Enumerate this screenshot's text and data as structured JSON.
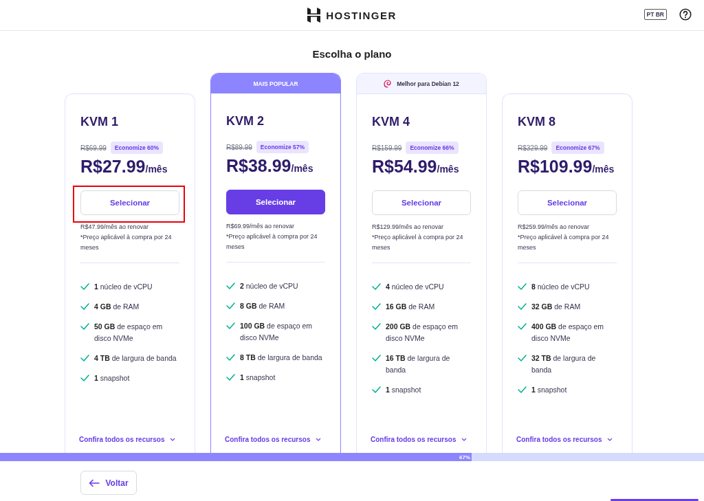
{
  "header": {
    "brand": "HOSTINGER",
    "language": "PT BR"
  },
  "title": "Escolha o plano",
  "plans": [
    {
      "name": "KVM 1",
      "old_price": "R$69.99",
      "discount": "Economize 60%",
      "price": "R$27.99",
      "period": "/mês",
      "button": {
        "label": "Selecionar",
        "primary": false
      },
      "highlighted": true,
      "renew": "R$47.99/mês ao renovar",
      "note": "*Preço aplicável à compra por 24 meses",
      "features": [
        "**1** núcleo de vCPU",
        "**4 GB** de RAM",
        "**50 GB** de espaço em disco NVMe",
        "**4 TB** de largura de banda",
        "**1** snapshot"
      ],
      "link": "Confira todos os recursos"
    },
    {
      "banner": {
        "kind": "popular",
        "text": "MAIS POPULAR"
      },
      "name": "KVM 2",
      "old_price": "R$89.99",
      "discount": "Economize 57%",
      "price": "R$38.99",
      "period": "/mês",
      "button": {
        "label": "Selecionar",
        "primary": true
      },
      "highlighted": false,
      "renew": "R$69.99/mês ao renovar",
      "note": "*Preço aplicável à compra por 24 meses",
      "features": [
        "**2** núcleo de vCPU",
        "**8 GB** de RAM",
        "**100 GB** de espaço em disco NVMe",
        "**8 TB** de largura de banda",
        "**1** snapshot"
      ],
      "link": "Confira todos os recursos"
    },
    {
      "banner": {
        "kind": "os",
        "text": "Melhor para Debian 12"
      },
      "name": "KVM 4",
      "old_price": "R$159.99",
      "discount": "Economize 66%",
      "price": "R$54.99",
      "period": "/mês",
      "button": {
        "label": "Selecionar",
        "primary": false
      },
      "highlighted": false,
      "renew": "R$129.99/mês ao renovar",
      "note": "*Preço aplicável à compra por 24 meses",
      "features": [
        "**4** núcleo de vCPU",
        "**16 GB** de RAM",
        "**200 GB** de espaço em disco NVMe",
        "**16 TB** de largura de banda",
        "**1** snapshot"
      ],
      "link": "Confira todos os recursos"
    },
    {
      "name": "KVM 8",
      "old_price": "R$329.99",
      "discount": "Economize 67%",
      "price": "R$109.99",
      "period": "/mês",
      "button": {
        "label": "Selecionar",
        "primary": false
      },
      "highlighted": false,
      "renew": "R$259.99/mês ao renovar",
      "note": "*Preço aplicável à compra por 24 meses",
      "features": [
        "**8** núcleo de vCPU",
        "**32 GB** de RAM",
        "**400 GB** de espaço em disco NVMe",
        "**32 TB** de largura de banda",
        "**1** snapshot"
      ],
      "link": "Confira todos os recursos"
    }
  ],
  "progress": {
    "level": 0.67,
    "label": "67%"
  },
  "footer": {
    "back": "Voltar"
  }
}
